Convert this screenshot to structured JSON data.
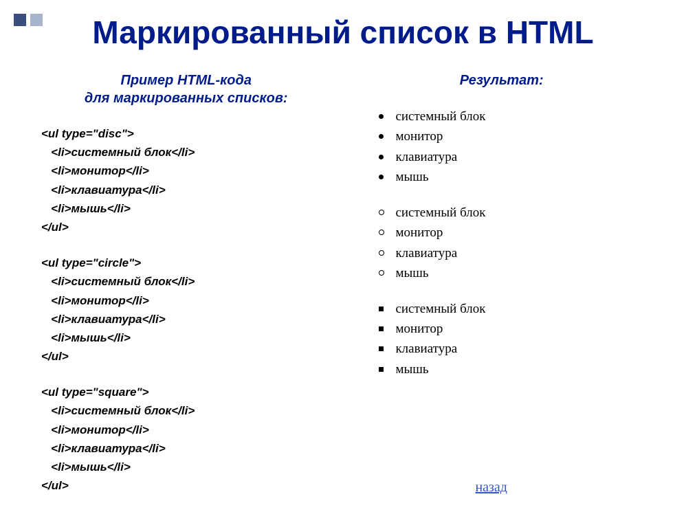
{
  "title": "Маркированный список в HTML",
  "left": {
    "subtitle_line1": "Пример HTML-кода",
    "subtitle_line2": "для маркированных списков:",
    "blocks": [
      {
        "open": "<ul type=\"disc\">",
        "items": [
          "   <li>системный блок</li>",
          "   <li>монитор</li>",
          "   <li>клавиатура</li>",
          "   <li>мышь</li>"
        ],
        "close": "</ul>"
      },
      {
        "open": "<ul type=\"circle\">",
        "items": [
          "   <li>системный блок</li>",
          "   <li>монитор</li>",
          "   <li>клавиатура</li>",
          "   <li>мышь</li>"
        ],
        "close": "</ul>"
      },
      {
        "open": "<ul type=\"square\">",
        "items": [
          "   <li>системный блок</li>",
          "   <li>монитор</li>",
          "   <li>клавиатура</li>",
          "   <li>мышь</li>"
        ],
        "close": "</ul>"
      }
    ]
  },
  "right": {
    "subtitle": "Результат:",
    "lists": [
      {
        "type": "disc",
        "items": [
          "системный блок",
          "монитор",
          "клавиатура",
          "мышь"
        ]
      },
      {
        "type": "circle",
        "items": [
          "системный блок",
          "монитор",
          "клавиатура",
          "мышь"
        ]
      },
      {
        "type": "square",
        "items": [
          "системный блок",
          "монитор",
          "клавиатура",
          "мышь"
        ]
      }
    ]
  },
  "back_link": "назад"
}
